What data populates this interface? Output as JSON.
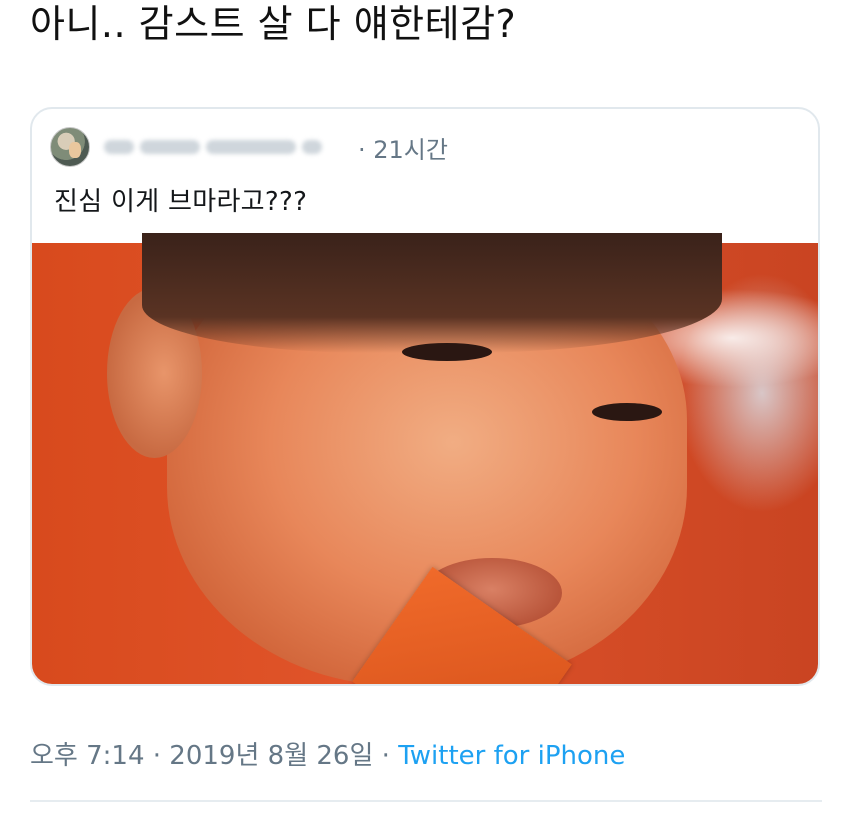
{
  "tweet": {
    "text": "아니.. 감스트 살 다 얘한테감?"
  },
  "quoted_tweet": {
    "time": "· 21시간",
    "body": "진심 이게 브마라고???"
  },
  "meta": {
    "time": "오후 7:14",
    "separator1": " · ",
    "date": "2019년 8월 26일",
    "separator2": " · ",
    "source": "Twitter for iPhone"
  },
  "colors": {
    "link": "#1da1f2",
    "secondary_text": "#657786",
    "border": "#e1e8ed"
  }
}
